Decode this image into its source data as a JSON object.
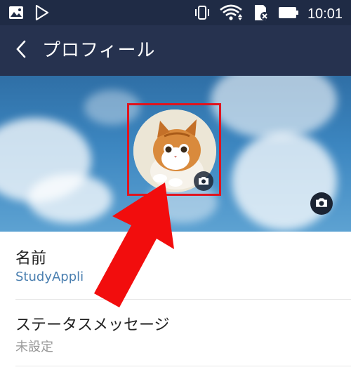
{
  "status": {
    "time": "10:01",
    "left_icons": [
      "image-icon",
      "play-store-icon"
    ],
    "right_icons": [
      "vibrate-icon",
      "wifi-icon",
      "sd-card-icon",
      "battery-icon"
    ]
  },
  "header": {
    "title": "プロフィール",
    "back_icon": "chevron-left-icon"
  },
  "profile": {
    "name_label": "名前",
    "name_value": "StudyAppli",
    "status_label": "ステータスメッセージ",
    "status_value": "未設定"
  },
  "colors": {
    "statusbar_bg": "#1f2b45",
    "header_bg": "#26324f",
    "highlight": "#e0141e",
    "name_value": "#4a7fb0",
    "status_value": "#9a9a9a"
  }
}
